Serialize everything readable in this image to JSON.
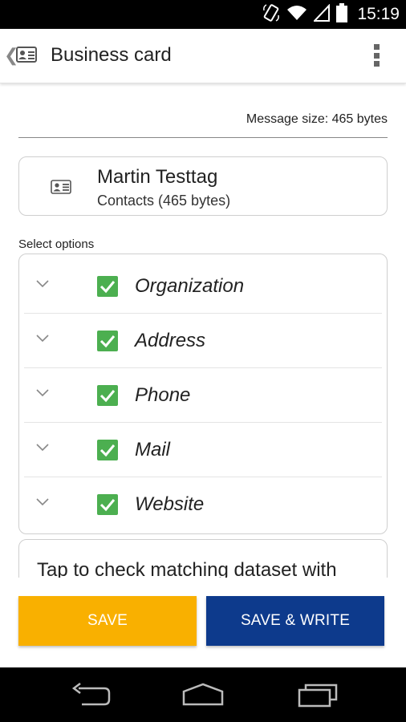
{
  "status_bar": {
    "time": "15:19",
    "icons": [
      "rotate-icon",
      "wifi-icon",
      "signal-icon",
      "battery-icon"
    ]
  },
  "action_bar": {
    "title": "Business card",
    "icons": [
      "back-chevron-icon",
      "contact-card-icon",
      "overflow-menu-icon"
    ]
  },
  "message_size": "Message size: 465 bytes",
  "contact": {
    "name": "Martin Testtag",
    "subtitle": "Contacts (465 bytes)",
    "icon": "contact-card-icon"
  },
  "select_options_label": "Select options",
  "options": [
    {
      "label": "Organization",
      "checked": true
    },
    {
      "label": "Address",
      "checked": true
    },
    {
      "label": "Phone",
      "checked": true
    },
    {
      "label": "Mail",
      "checked": true
    },
    {
      "label": "Website",
      "checked": true
    }
  ],
  "hint": "Tap to check matching dataset with",
  "buttons": {
    "save": "SAVE",
    "save_write": "SAVE & WRITE"
  },
  "nav_bar": {
    "icons": [
      "back-icon",
      "home-icon",
      "recents-icon"
    ]
  },
  "colors": {
    "save": "#f9b000",
    "save_write": "#0d3a8c",
    "checkbox": "#4caf50"
  }
}
